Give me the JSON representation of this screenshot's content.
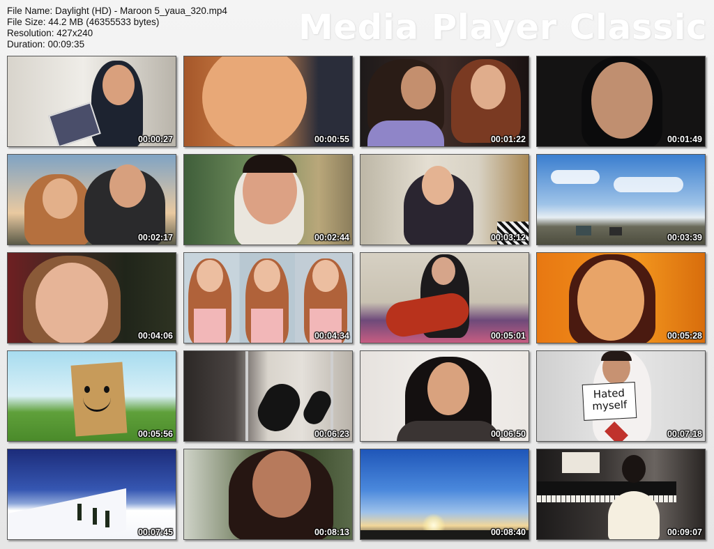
{
  "file_info": {
    "file_name": "File Name: Daylight (HD) - Maroon 5_yaua_320.mp4",
    "file_size": "File Size: 44.2 MB (46355533 bytes)",
    "resolution": "Resolution: 427x240",
    "duration": "Duration: 00:09:35"
  },
  "brand": "Media Player Classic",
  "thumbnails": [
    {
      "time": "00:00:27"
    },
    {
      "time": "00:00:55"
    },
    {
      "time": "00:01:22"
    },
    {
      "time": "00:01:49"
    },
    {
      "time": "00:02:17"
    },
    {
      "time": "00:02:44"
    },
    {
      "time": "00:03:12"
    },
    {
      "time": "00:03:39"
    },
    {
      "time": "00:04:06"
    },
    {
      "time": "00:04:34"
    },
    {
      "time": "00:05:01"
    },
    {
      "time": "00:05:28"
    },
    {
      "time": "00:05:56"
    },
    {
      "time": "00:06:23"
    },
    {
      "time": "00:06:50"
    },
    {
      "time": "00:07:18"
    },
    {
      "time": "00:07:45"
    },
    {
      "time": "00:08:13"
    },
    {
      "time": "00:08:40"
    },
    {
      "time": "00:09:07"
    }
  ],
  "sign_text": "Hated myself"
}
